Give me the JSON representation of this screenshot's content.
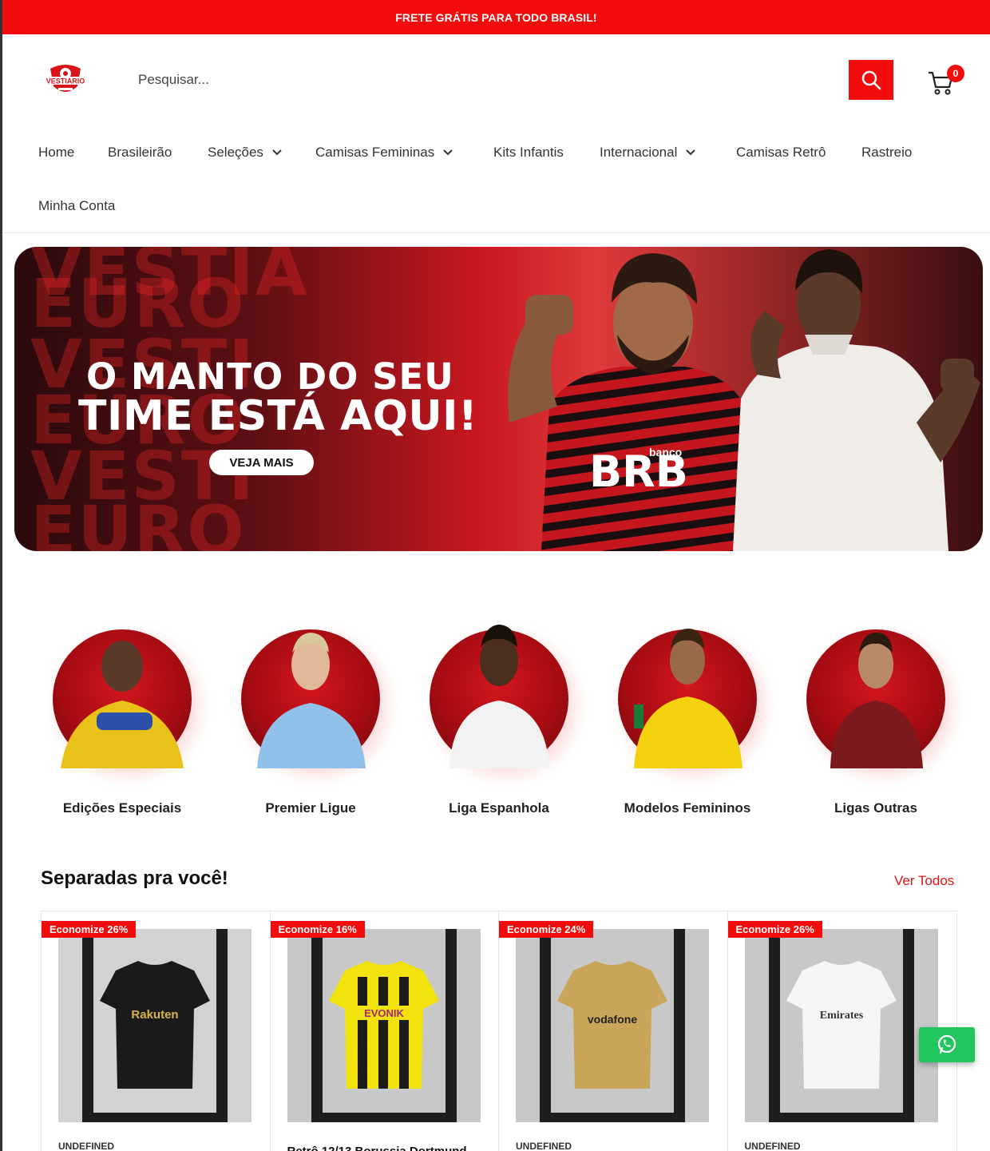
{
  "topbar": {
    "text": "FRETE GRÁTIS PARA TODO BRASIL!"
  },
  "header": {
    "logo_text": "VESTIARIO",
    "search_placeholder": "Pesquisar...",
    "cart_count": "0"
  },
  "nav": {
    "items": [
      {
        "label": "Home",
        "has_dropdown": false
      },
      {
        "label": "Brasileirão",
        "has_dropdown": false
      },
      {
        "label": "Seleções",
        "has_dropdown": true
      },
      {
        "label": "Camisas Femininas",
        "has_dropdown": true
      },
      {
        "label": "Kits Infantis",
        "has_dropdown": false
      },
      {
        "label": "Internacional",
        "has_dropdown": true
      },
      {
        "label": "Camisas Retrô",
        "has_dropdown": false
      },
      {
        "label": "Rastreio",
        "has_dropdown": false
      },
      {
        "label": "Minha Conta",
        "has_dropdown": false
      }
    ]
  },
  "banner": {
    "bg_words": [
      "VESTIÁ",
      "EURO",
      "VESTI",
      "EURO",
      "VESTI",
      "EURO"
    ],
    "line1": "O MANTO DO SEU",
    "line2": "TIME ESTÁ AQUI!",
    "button": "VEJA MAIS",
    "sponsor_text": "BRB",
    "sponsor_small": "banco"
  },
  "categories": [
    {
      "label": "Edições Especiais",
      "jersey_color": "#e8c21a"
    },
    {
      "label": "Premier Ligue",
      "jersey_color": "#8fc1ea"
    },
    {
      "label": "Liga Espanhola",
      "jersey_color": "#f2f2f2"
    },
    {
      "label": "Modelos Femininos",
      "jersey_color": "#f4d20f"
    },
    {
      "label": "Ligas Outras",
      "jersey_color": "#7a1a1f"
    }
  ],
  "section": {
    "title": "Separadas pra você!",
    "view_all": "Ver Todos"
  },
  "products": [
    {
      "badge": "Economize 26%",
      "vendor": "UNDEFINED",
      "title": "",
      "shirt_color": "#1a1a1a",
      "print": "Rakuten",
      "print_color": "#d9b34c"
    },
    {
      "badge": "Economize 16%",
      "vendor": "",
      "title": "Retrô 12/13 Borussia Dortmund",
      "shirt_color": "#f2e20c",
      "print": "EVONIK",
      "print_color": "#a32a7a"
    },
    {
      "badge": "Economize 24%",
      "vendor": "UNDEFINED",
      "title": "",
      "shirt_color": "#c9a55a",
      "print": "vodafone",
      "print_color": "#222222"
    },
    {
      "badge": "Economize 26%",
      "vendor": "UNDEFINED",
      "title": "",
      "shirt_color": "#f5f5f5",
      "print": "Emirates",
      "print_color": "#333333"
    }
  ],
  "colors": {
    "brand_red": "#f20c0c",
    "whatsapp_green": "#22c55e"
  }
}
